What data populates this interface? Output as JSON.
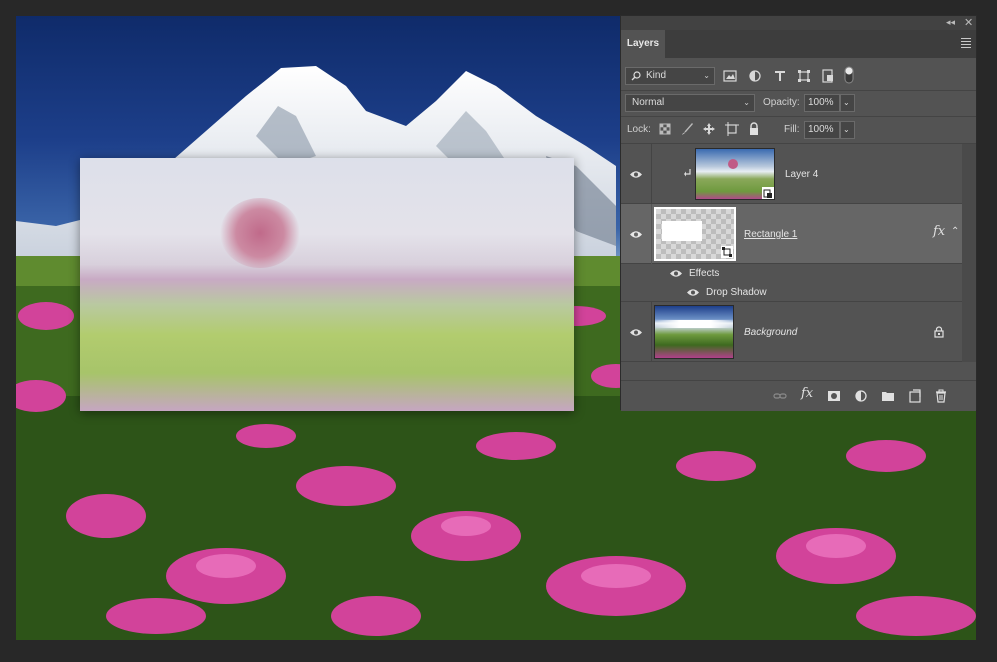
{
  "panel": {
    "title": "Layers",
    "collapse_glyph": "◂◂",
    "close_glyph": "✕"
  },
  "filter": {
    "kind_label": "Kind",
    "icons": [
      "image-filter-icon",
      "adjustment-filter-icon",
      "type-filter-icon",
      "shape-filter-icon",
      "smart-object-filter-icon",
      "filter-toggle-icon"
    ]
  },
  "blend": {
    "mode": "Normal",
    "opacity_label": "Opacity:",
    "opacity_value": "100%",
    "lock_label": "Lock:",
    "fill_label": "Fill:",
    "fill_value": "100%"
  },
  "layers": [
    {
      "name": "Layer 4",
      "type": "smart-object",
      "clipped": true,
      "visible": true,
      "selected": false
    },
    {
      "name": "Rectangle 1",
      "type": "shape",
      "visible": true,
      "selected": true,
      "fx": "fx",
      "effects_label": "Effects",
      "effects": [
        "Drop Shadow"
      ]
    },
    {
      "name": "Background",
      "type": "background",
      "visible": true,
      "locked": true,
      "selected": false
    }
  ],
  "bottom_fx_label": "fx",
  "colors": {
    "panel_bg": "#535353",
    "selected_row": "#666666",
    "workspace": "#282828"
  }
}
